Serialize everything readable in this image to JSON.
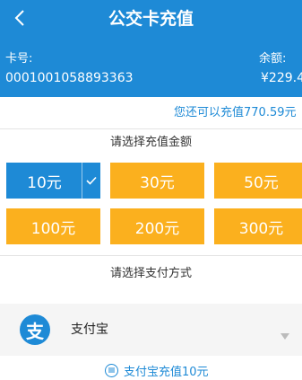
{
  "header": {
    "title": "公交卡充值",
    "card_label": "卡号:",
    "card_number": "0001001058893363",
    "balance_label": "余额:",
    "balance_value": "¥229.4"
  },
  "remaining_text": "您还可以充值770.59元",
  "amount_section": {
    "title": "请选择充值金额",
    "options": [
      {
        "label": "10元",
        "selected": true
      },
      {
        "label": "30元",
        "selected": false
      },
      {
        "label": "50元",
        "selected": false
      },
      {
        "label": "100元",
        "selected": false
      },
      {
        "label": "200元",
        "selected": false
      },
      {
        "label": "300元",
        "selected": false
      }
    ]
  },
  "payment_section": {
    "title": "请选择支付方式",
    "method_logo": "支",
    "method": "支付宝"
  },
  "confirm_label": "支付宝充值10元",
  "icons": [
    "back-icon",
    "check-icon",
    "alipay-icon",
    "dropdown-icon",
    "list-icon"
  ],
  "colors": {
    "primary": "#1e8ad6",
    "amount_button": "#fbb01e",
    "amount_selected": "#1e8ad6"
  }
}
